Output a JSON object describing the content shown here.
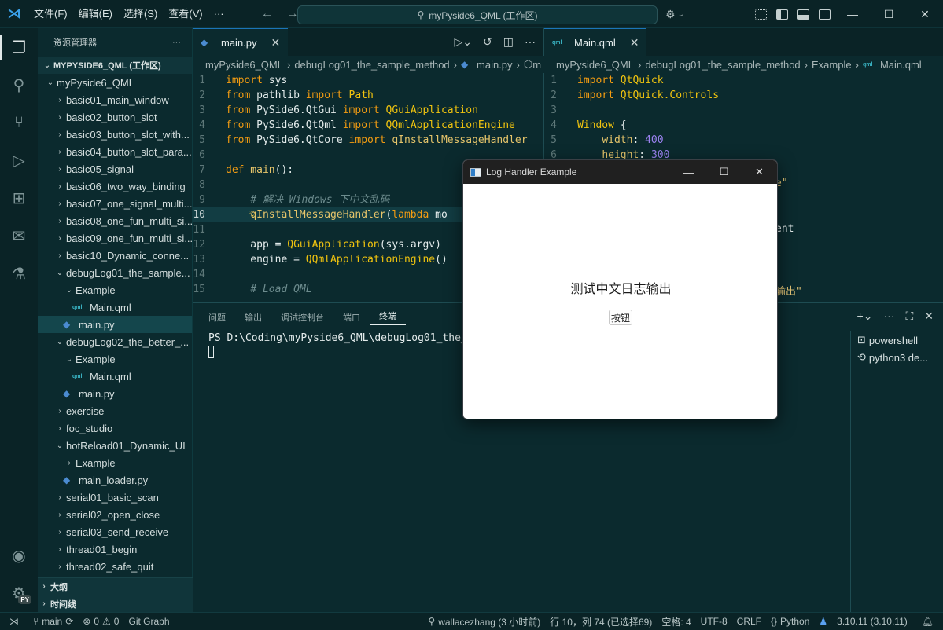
{
  "titlebar": {
    "menu": [
      "文件(F)",
      "编辑(E)",
      "选择(S)",
      "查看(V)",
      "···"
    ],
    "search": "myPyside6_QML (工作区)"
  },
  "sidebar": {
    "title": "资源管理器",
    "more": "···",
    "workspace": "MYPYSIDE6_QML (工作区)",
    "tree": [
      {
        "label": "myPyside6_QML",
        "depth": 1,
        "kind": "folder",
        "open": true
      },
      {
        "label": "basic01_main_window",
        "depth": 2,
        "kind": "folder"
      },
      {
        "label": "basic02_button_slot",
        "depth": 2,
        "kind": "folder"
      },
      {
        "label": "basic03_button_slot_with...",
        "depth": 2,
        "kind": "folder"
      },
      {
        "label": "basic04_button_slot_para...",
        "depth": 2,
        "kind": "folder"
      },
      {
        "label": "basic05_signal",
        "depth": 2,
        "kind": "folder"
      },
      {
        "label": "basic06_two_way_binding",
        "depth": 2,
        "kind": "folder"
      },
      {
        "label": "basic07_one_signal_multi...",
        "depth": 2,
        "kind": "folder"
      },
      {
        "label": "basic08_one_fun_multi_si...",
        "depth": 2,
        "kind": "folder"
      },
      {
        "label": "basic09_one_fun_multi_si...",
        "depth": 2,
        "kind": "folder"
      },
      {
        "label": "basic10_Dynamic_conne...",
        "depth": 2,
        "kind": "folder"
      },
      {
        "label": "debugLog01_the_sample...",
        "depth": 2,
        "kind": "folder",
        "open": true
      },
      {
        "label": "Example",
        "depth": 3,
        "kind": "folder",
        "open": true
      },
      {
        "label": "Main.qml",
        "depth": 4,
        "kind": "qml"
      },
      {
        "label": "main.py",
        "depth": 3,
        "kind": "py",
        "selected": true
      },
      {
        "label": "debugLog02_the_better_...",
        "depth": 2,
        "kind": "folder",
        "open": true
      },
      {
        "label": "Example",
        "depth": 3,
        "kind": "folder",
        "open": true
      },
      {
        "label": "Main.qml",
        "depth": 4,
        "kind": "qml"
      },
      {
        "label": "main.py",
        "depth": 3,
        "kind": "py"
      },
      {
        "label": "exercise",
        "depth": 2,
        "kind": "folder"
      },
      {
        "label": "foc_studio",
        "depth": 2,
        "kind": "folder"
      },
      {
        "label": "hotReload01_Dynamic_UI",
        "depth": 2,
        "kind": "folder",
        "open": true
      },
      {
        "label": "Example",
        "depth": 3,
        "kind": "folder"
      },
      {
        "label": "main_loader.py",
        "depth": 3,
        "kind": "py"
      },
      {
        "label": "serial01_basic_scan",
        "depth": 2,
        "kind": "folder"
      },
      {
        "label": "serial02_open_close",
        "depth": 2,
        "kind": "folder"
      },
      {
        "label": "serial03_send_receive",
        "depth": 2,
        "kind": "folder"
      },
      {
        "label": "thread01_begin",
        "depth": 2,
        "kind": "folder"
      },
      {
        "label": "thread02_safe_quit",
        "depth": 2,
        "kind": "folder"
      }
    ],
    "outline": "大纲",
    "timeline": "时间线"
  },
  "editor_left": {
    "tab": "main.py",
    "breadcrumb": [
      "myPyside6_QML",
      "debugLog01_the_sample_method",
      "main.py",
      "m"
    ],
    "lines": [
      {
        "n": "1",
        "code": [
          [
            "kw",
            "import"
          ],
          [
            "plain",
            " sys"
          ]
        ]
      },
      {
        "n": "2",
        "code": [
          [
            "kw",
            "from"
          ],
          [
            "plain",
            " pathlib "
          ],
          [
            "kw",
            "import"
          ],
          [
            "cls",
            " Path"
          ]
        ]
      },
      {
        "n": "3",
        "code": [
          [
            "kw",
            "from"
          ],
          [
            "plain",
            " PySide6.QtGui "
          ],
          [
            "kw",
            "import"
          ],
          [
            "cls",
            " QGuiApplication"
          ]
        ]
      },
      {
        "n": "4",
        "code": [
          [
            "kw",
            "from"
          ],
          [
            "plain",
            " PySide6.QtQml "
          ],
          [
            "kw",
            "import"
          ],
          [
            "cls",
            " QQmlApplicationEngine"
          ]
        ]
      },
      {
        "n": "5",
        "code": [
          [
            "kw",
            "from"
          ],
          [
            "plain",
            " PySide6.QtCore "
          ],
          [
            "kw",
            "import"
          ],
          [
            "fn",
            " qInstallMessageHandler"
          ]
        ]
      },
      {
        "n": "6",
        "code": []
      },
      {
        "n": "7",
        "code": [
          [
            "kw",
            "def"
          ],
          [
            "fn",
            " main"
          ],
          [
            "plain",
            "():"
          ]
        ]
      },
      {
        "n": "8",
        "code": []
      },
      {
        "n": "9",
        "code": [
          [
            "plain",
            "    "
          ],
          [
            "cm",
            "# 解决 Windows 下中文乱码"
          ]
        ]
      },
      {
        "n": "10",
        "code": [
          [
            "plain",
            "    "
          ],
          [
            "fn",
            "qInstallMessageHandler"
          ],
          [
            "plain",
            "("
          ],
          [
            "kw",
            "lambda"
          ],
          [
            "plain",
            " mo"
          ]
        ]
      },
      {
        "n": "11",
        "code": []
      },
      {
        "n": "12",
        "code": [
          [
            "plain",
            "    app = "
          ],
          [
            "cls",
            "QGuiApplication"
          ],
          [
            "plain",
            "(sys.argv)"
          ]
        ]
      },
      {
        "n": "13",
        "code": [
          [
            "plain",
            "    engine = "
          ],
          [
            "cls",
            "QQmlApplicationEngine"
          ],
          [
            "plain",
            "()"
          ]
        ]
      },
      {
        "n": "14",
        "code": []
      },
      {
        "n": "15",
        "code": [
          [
            "plain",
            "    "
          ],
          [
            "cm",
            "# Load QML"
          ]
        ]
      }
    ]
  },
  "editor_right": {
    "tab": "Main.qml",
    "breadcrumb": [
      "myPyside6_QML",
      "debugLog01_the_sample_method",
      "Example",
      "Main.qml"
    ],
    "lines": [
      {
        "n": "1",
        "code": [
          [
            "kw",
            "import"
          ],
          [
            "cls",
            " QtQuick"
          ]
        ]
      },
      {
        "n": "2",
        "code": [
          [
            "kw",
            "import"
          ],
          [
            "cls",
            " QtQuick.Controls"
          ]
        ]
      },
      {
        "n": "3",
        "code": []
      },
      {
        "n": "4",
        "code": [
          [
            "cls",
            "Window"
          ],
          [
            "plain",
            " {"
          ]
        ]
      },
      {
        "n": "5",
        "code": [
          [
            "plain",
            "    "
          ],
          [
            "fn",
            "width"
          ],
          [
            "plain",
            ": "
          ],
          [
            "num",
            "400"
          ]
        ]
      },
      {
        "n": "6",
        "code": [
          [
            "plain",
            "    "
          ],
          [
            "fn",
            "height"
          ],
          [
            "plain",
            ": "
          ],
          [
            "num",
            "300"
          ]
        ]
      }
    ],
    "partial": [
      "e\"",
      "ent",
      "输出\""
    ]
  },
  "panel": {
    "tabs": [
      "问题",
      "输出",
      "调试控制台",
      "端口",
      "终端"
    ],
    "active_tab": "终端",
    "terminal_line": "PS D:\\Coding\\myPyside6_QML\\debugLog01_the_samp",
    "terminals": [
      "powershell",
      "python3 de..."
    ]
  },
  "dialog": {
    "title": "Log Handler Example",
    "message": "测试中文日志输出",
    "button": "按钮"
  },
  "status": {
    "branch": "main",
    "errors": "0",
    "warnings": "0",
    "git_graph": "Git Graph",
    "blame": "wallacezhang (3 小时前)",
    "position": "行 10，列 74 (已选择69)",
    "spaces": "空格: 4",
    "encoding": "UTF-8",
    "eol": "CRLF",
    "language": "Python",
    "interpreter": "3.10.11 (3.10.11)"
  }
}
